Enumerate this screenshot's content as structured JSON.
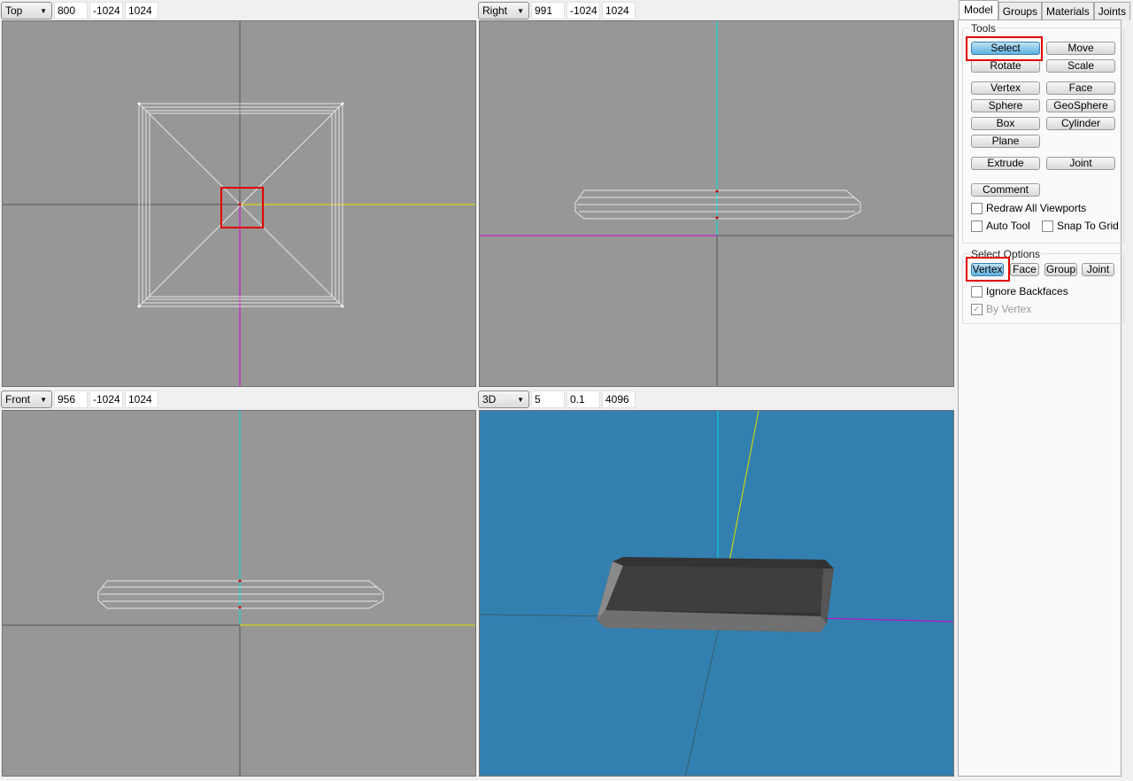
{
  "viewports": [
    {
      "view": "Top",
      "fields": [
        "800",
        "-1024",
        "1024"
      ]
    },
    {
      "view": "Right",
      "fields": [
        "991",
        "-1024",
        "1024"
      ]
    },
    {
      "view": "Front",
      "fields": [
        "956",
        "-1024",
        "1024"
      ]
    },
    {
      "view": "3D",
      "fields": [
        "5",
        "0.1",
        "4096"
      ]
    }
  ],
  "colors": {
    "viewport_bg": "#979797",
    "viewport_3d_bg": "#3380b0",
    "selection_highlight": "#e00000"
  },
  "panel": {
    "tabs": [
      "Model",
      "Groups",
      "Materials",
      "Joints"
    ],
    "tools_label": "Tools",
    "tools": [
      "Select",
      "Move",
      "Rotate",
      "Scale",
      "Vertex",
      "Face",
      "Sphere",
      "GeoSphere",
      "Box",
      "Cylinder",
      "Plane",
      "Extrude",
      "Joint",
      "Comment"
    ],
    "active_tool": "Select",
    "redraw_all": {
      "label": "Redraw All Viewports",
      "checked": false
    },
    "auto_tool": {
      "label": "Auto Tool",
      "checked": false
    },
    "snap_grid": {
      "label": "Snap To Grid",
      "checked": false
    },
    "select_label": "Select Options",
    "select_modes": [
      "Vertex",
      "Face",
      "Group",
      "Joint"
    ],
    "active_mode": "Vertex",
    "ignore_backfaces": {
      "label": "Ignore Backfaces",
      "checked": false
    },
    "by_vertex": {
      "label": "By Vertex",
      "checked": true,
      "disabled": true
    }
  }
}
